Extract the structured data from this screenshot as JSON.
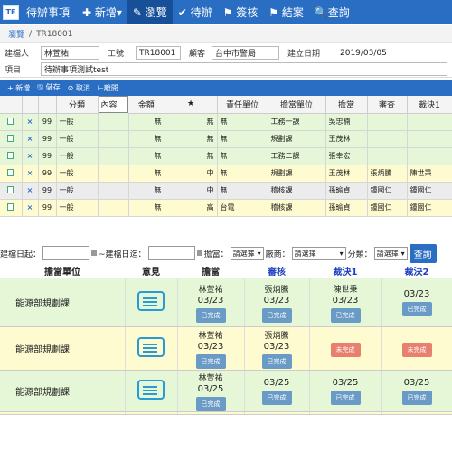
{
  "nav": {
    "logo": "TE",
    "title": "待辦事項",
    "items": [
      {
        "label": "✚ 新增▾",
        "active": false
      },
      {
        "label": "✎ 瀏覽",
        "active": true
      },
      {
        "label": "✔ 待辦",
        "active": false
      },
      {
        "label": "⚑ 簽核",
        "active": false
      },
      {
        "label": "⚑ 結案",
        "active": false
      },
      {
        "label": "🔍查詢",
        "active": false
      }
    ]
  },
  "breadcrumb": {
    "root": "瀏覽",
    "sep": "/",
    "current": "TR18001"
  },
  "form": {
    "creator_label": "建檔人",
    "creator": "林萱祐",
    "no_label": "工號",
    "no": "TR18001",
    "customer_label": "顧客",
    "customer": "台中市警局",
    "date_label": "建立日期",
    "date": "2019/03/05",
    "item_label": "項目",
    "item": "待辦事項測試test"
  },
  "actions": [
    "+ 新增",
    "🖫 儲存",
    "⊘ 取消",
    "⊢離開"
  ],
  "grid1": {
    "headers": [
      "",
      "",
      "",
      "分類",
      "內容",
      "金額",
      "★",
      "責任單位",
      "擔當單位",
      "擔當",
      "審查",
      "裁決1"
    ],
    "rows": [
      {
        "style": "green",
        "del": "×",
        "no": "99",
        "cat": "一般",
        "content": "",
        "amt": "無",
        "star": "無",
        "resp": "無",
        "unit": "工務一課",
        "owner": "吳忠楠",
        "review": "",
        "dec": ""
      },
      {
        "style": "green",
        "del": "×",
        "no": "99",
        "cat": "一般",
        "content": "",
        "amt": "無",
        "star": "無",
        "resp": "無",
        "unit": "規劃課",
        "owner": "王茂林",
        "review": "",
        "dec": ""
      },
      {
        "style": "green",
        "del": "×",
        "no": "99",
        "cat": "一般",
        "content": "",
        "amt": "無",
        "star": "無",
        "resp": "無",
        "unit": "工務二課",
        "owner": "張幸宏",
        "review": "",
        "dec": ""
      },
      {
        "style": "yellow",
        "del": "×",
        "no": "99",
        "cat": "一般",
        "content": "",
        "amt": "無",
        "star": "中",
        "resp": "無",
        "unit": "規劃課",
        "owner": "王茂林",
        "review": "張炳騰",
        "dec": "陳世秉"
      },
      {
        "style": "grey",
        "del": "×",
        "no": "99",
        "cat": "一般",
        "content": "",
        "amt": "無",
        "star": "中",
        "resp": "無",
        "unit": "稽核課",
        "owner": "孫瑜貞",
        "review": "鍾國仁",
        "dec": "鍾國仁"
      },
      {
        "style": "yellow",
        "del": "×",
        "no": "99",
        "cat": "一般",
        "content": "",
        "amt": "無",
        "star": "高",
        "resp": "台電",
        "unit": "稽核課",
        "owner": "孫瑜貞",
        "review": "鍾國仁",
        "dec": "鍾國仁"
      }
    ]
  },
  "filter": {
    "created_from": "建檔日起：",
    "tilde": "~建檔日迄：",
    "owner": "擔當：",
    "owner_sel": "請選擇",
    "customer": "廠商：",
    "customer_sel": "請選擇",
    "cat": "分類：",
    "cat_sel": "請選擇",
    "query": "查詢"
  },
  "grid2": {
    "headers": [
      "擔當單位",
      "意見",
      "擔當",
      "審核",
      "裁決1",
      "裁決2"
    ],
    "rows": [
      {
        "style": "green",
        "unit": "能源部規劃課",
        "owner": {
          "name": "林萱祐",
          "date": "03/23",
          "status": "已完成",
          "state": "done"
        },
        "review": {
          "name": "張炳騰",
          "date": "03/23",
          "status": "已完成",
          "state": "done"
        },
        "dec1": {
          "name": "陳世秉",
          "date": "03/23",
          "status": "已完成",
          "state": "done"
        },
        "dec2": {
          "name": "",
          "date": "03/23",
          "status": "已完成",
          "state": "done"
        }
      },
      {
        "style": "yellow",
        "unit": "能源部規劃課",
        "owner": {
          "name": "林萱祐",
          "date": "03/23",
          "status": "已完成",
          "state": "done"
        },
        "review": {
          "name": "張炳騰",
          "date": "03/23",
          "status": "已完成",
          "state": "done"
        },
        "dec1": {
          "name": "",
          "date": "",
          "status": "未完成",
          "state": "undone"
        },
        "dec2": {
          "name": "",
          "date": "",
          "status": "未完成",
          "state": "undone"
        }
      },
      {
        "style": "green",
        "unit": "能源部規劃課",
        "owner": {
          "name": "林萱祐",
          "date": "03/25",
          "status": "已完成",
          "state": "done"
        },
        "review": {
          "name": "",
          "date": "03/25",
          "status": "已完成",
          "state": "done"
        },
        "dec1": {
          "name": "",
          "date": "03/25",
          "status": "已完成",
          "state": "done"
        },
        "dec2": {
          "name": "",
          "date": "03/25",
          "status": "已完成",
          "state": "done"
        }
      },
      {
        "style": "yellow",
        "unit": "",
        "owner": {
          "name": "",
          "date": "",
          "status": "",
          "state": ""
        },
        "review": {
          "name": "",
          "date": "",
          "status": "",
          "state": ""
        },
        "dec1": {
          "name": "",
          "date": "",
          "status": "",
          "state": ""
        },
        "dec2": {
          "name": "",
          "date": "",
          "status": "",
          "state": ""
        }
      }
    ]
  }
}
